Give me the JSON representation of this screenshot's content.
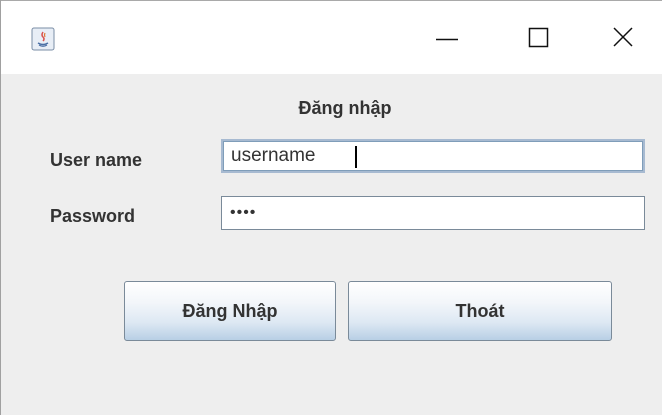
{
  "window": {
    "controls": {
      "minimize_icon": "minimize-icon",
      "maximize_icon": "maximize-icon",
      "close_icon": "close-icon"
    },
    "app_icon": "java-icon"
  },
  "form": {
    "heading": "Đăng nhập",
    "username_label": "User name",
    "username_value": "username",
    "password_label": "Password",
    "password_value": "••••"
  },
  "buttons": {
    "login_label": "Đăng Nhập",
    "exit_label": "Thoát"
  },
  "colors": {
    "window_background": "#eeeeee",
    "titlebar_background": "#ffffff",
    "button_gradient_bottom": "#b8cfe5",
    "focus_border": "#7f9db9"
  }
}
